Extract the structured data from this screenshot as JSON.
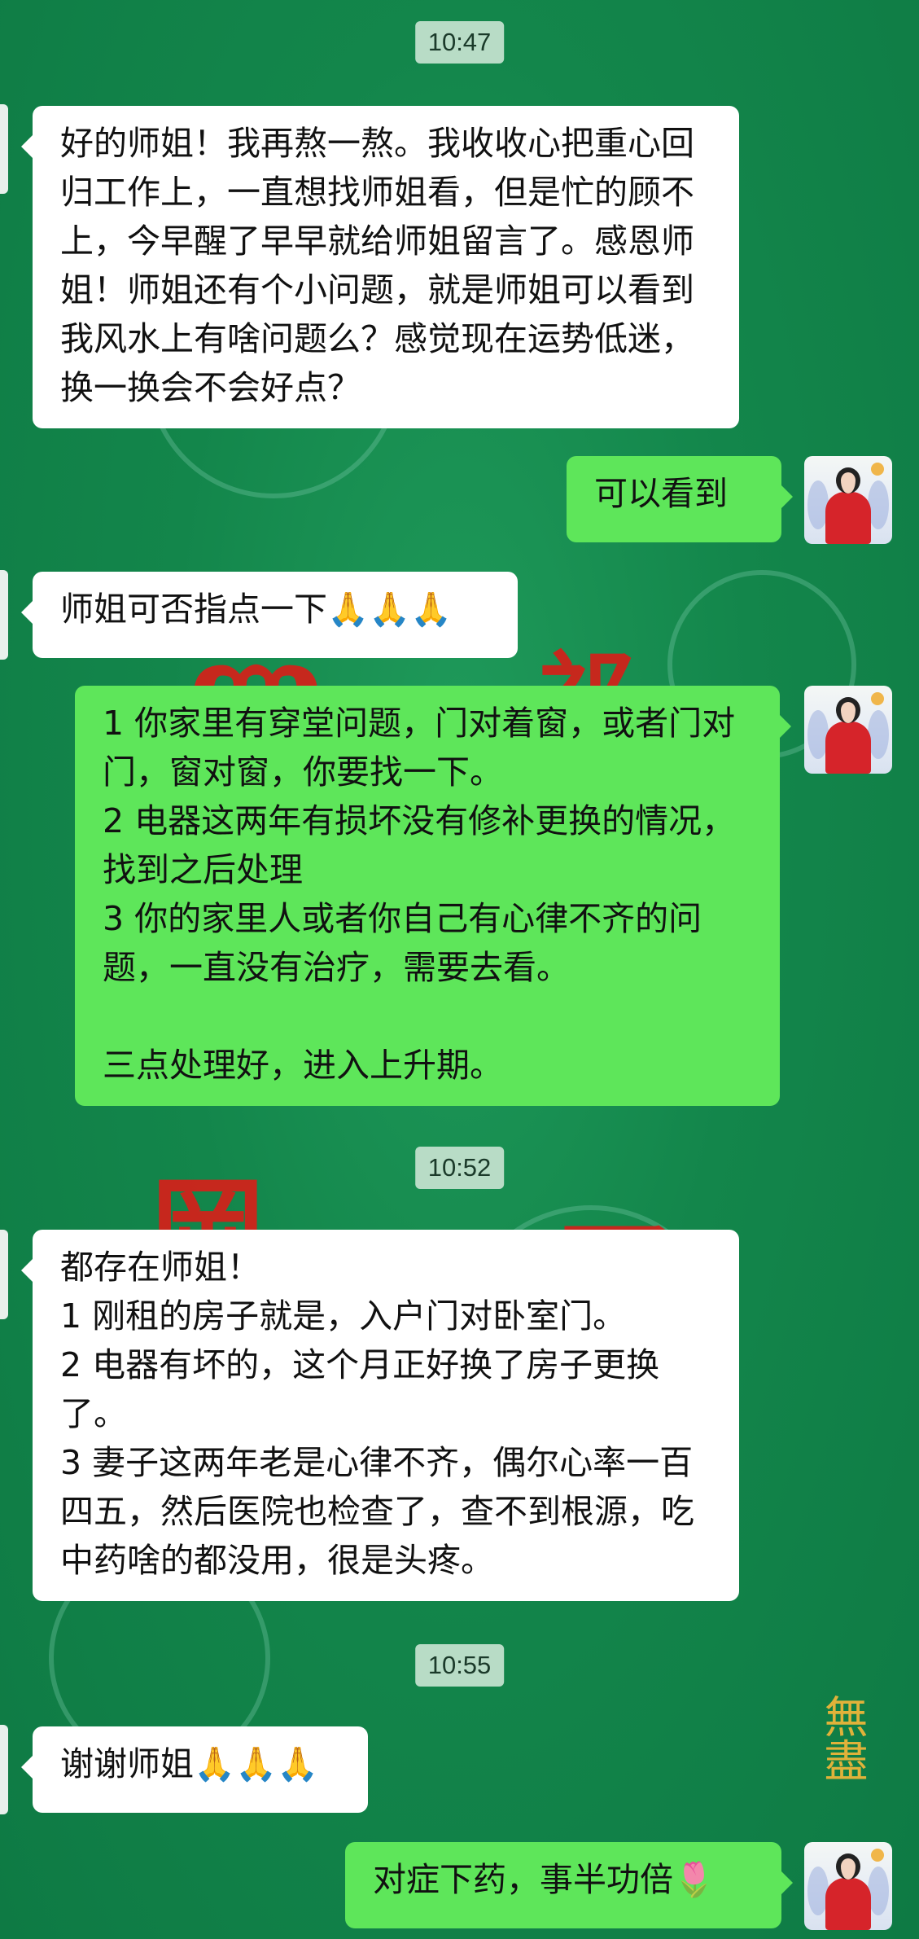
{
  "timestamps": [
    "10:47",
    "10:52",
    "10:55"
  ],
  "messages": [
    {
      "text": "好的师姐！我再熬一熬。我收收心把重心回归工作上，一直想找师姐看，但是忙的顾不上，今早醒了早早就给师姐留言了。感恩师姐！师姐还有个小问题，就是师姐可以看到我风水上有啥问题么？感觉现在运势低迷，换一换会不会好点？"
    },
    {
      "text": "可以看到"
    },
    {
      "text": "师姐可否指点一下🙏🙏🙏"
    },
    {
      "text": "1 你家里有穿堂问题，门对着窗，或者门对门，窗对窗，你要找一下。\n2 电器这两年有损坏没有修补更换的情况，找到之后处理\n3 你的家里人或者你自己有心律不齐的问题，一直没有治疗，需要去看。\n\n三点处理好，进入上升期。"
    },
    {
      "text": "都存在师姐！\n1 刚租的房子就是，入户门对卧室门。\n2 电器有坏的，这个月正好换了房子更换了。\n3 妻子这两年老是心律不齐，偶尔心率一百四五，然后医院也检查了，查不到根源，吃中药啥的都没用，很是头疼。"
    },
    {
      "text": "谢谢师姐🙏🙏🙏"
    },
    {
      "text": "对症下药，事半功倍🌷"
    }
  ],
  "colors": {
    "incoming": "#ffffff",
    "outgoing": "#5ee65a",
    "background": "#13864b",
    "timestamp_bg": "#b8dcc6"
  },
  "decor": {
    "watermark": "無盡"
  }
}
